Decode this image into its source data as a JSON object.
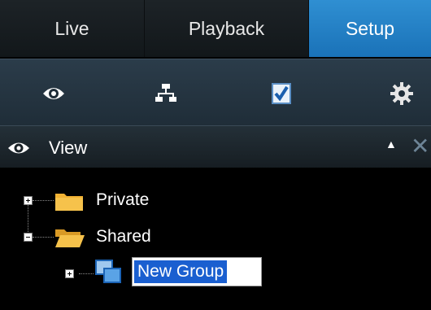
{
  "tabs": [
    {
      "label": "Live",
      "active": false
    },
    {
      "label": "Playback",
      "active": false
    },
    {
      "label": "Setup",
      "active": true
    }
  ],
  "toolbar": {
    "icons": [
      "eye-icon",
      "network-icon",
      "checklist-document-icon",
      "gear-icon"
    ]
  },
  "pane": {
    "title": "View",
    "collapse_glyph": "▲",
    "close_glyph": "✕"
  },
  "tree": {
    "private_label": "Private",
    "shared_label": "Shared",
    "new_group_value": "New Group"
  },
  "colors": {
    "active_tab": "#2f8fd2",
    "selection": "#1a5fd0",
    "folder": "#f2b233"
  }
}
